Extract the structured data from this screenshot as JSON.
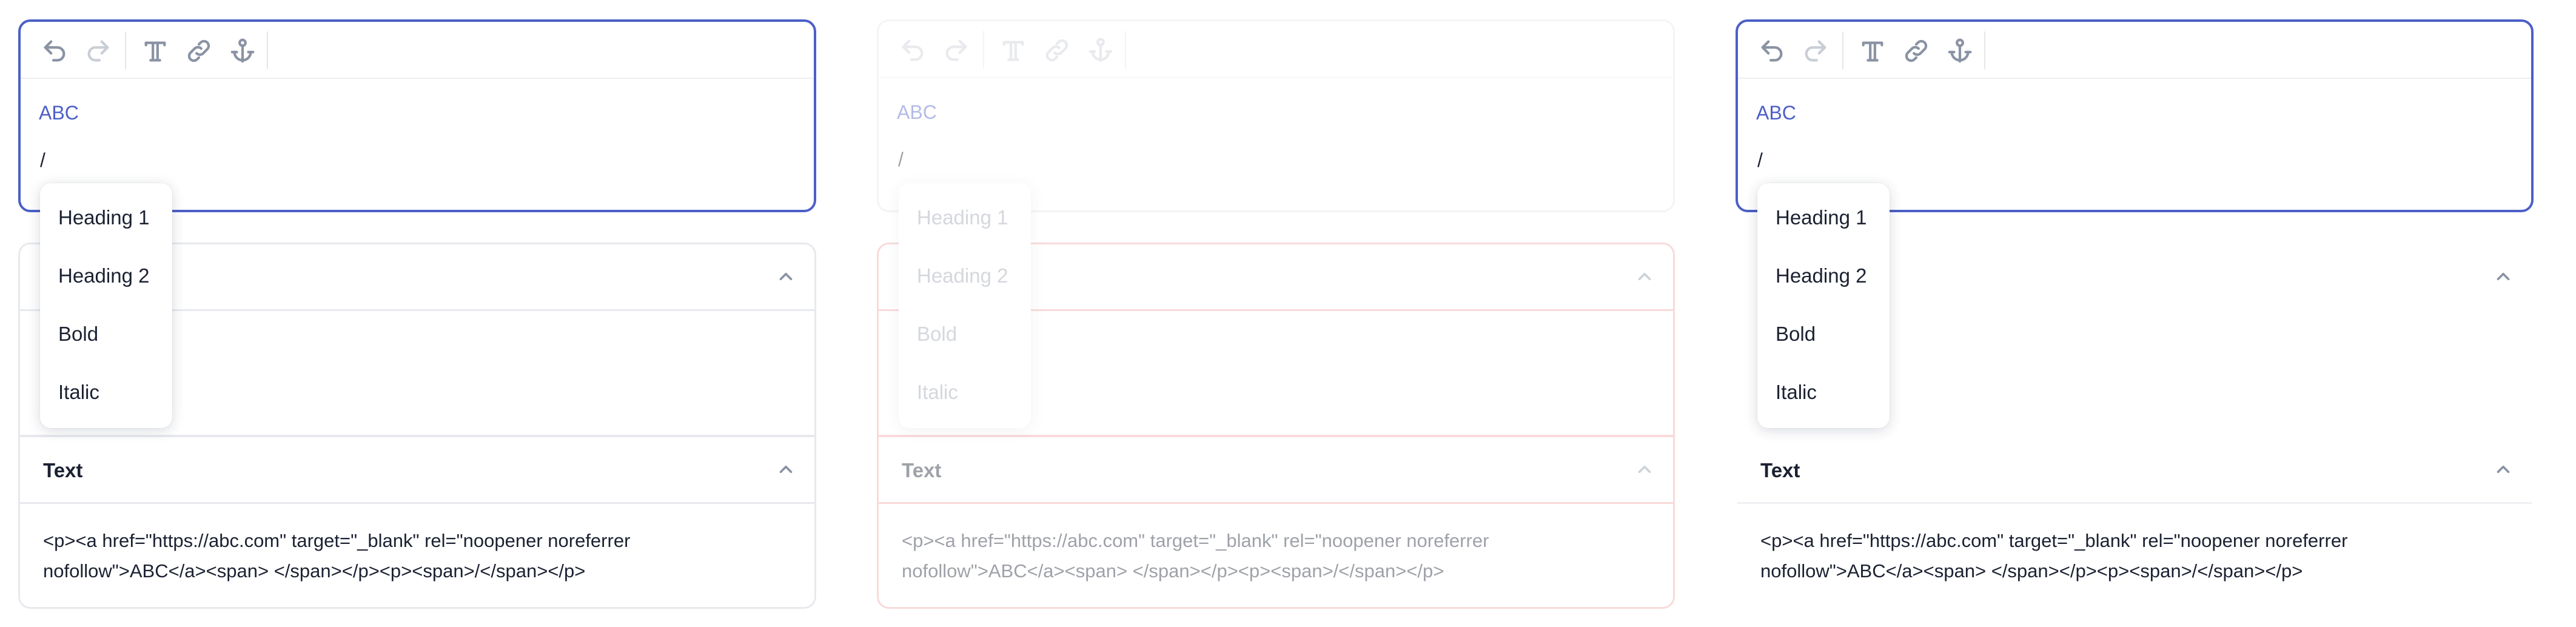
{
  "panels": [
    {
      "state": "focused",
      "toolbar": {
        "undo": "undo-icon",
        "redo": "redo-icon",
        "text_style": "text-style-icon",
        "link": "link-icon",
        "anchor": "anchor-icon"
      },
      "editor": {
        "link_text": "ABC",
        "slash_text": "/"
      },
      "menu": [
        "Heading 1",
        "Heading 2",
        "Bold",
        "Italic"
      ],
      "sections": [
        {
          "title": ""
        },
        {
          "title": "Text",
          "html_output": "<p><a href=\"https://abc.com\" target=\"_blank\" rel=\"noopener noreferrer nofollow\">ABC</a><span> </span></p><p><span>/</span></p>"
        }
      ]
    },
    {
      "state": "disabled",
      "toolbar": {
        "undo": "undo-icon",
        "redo": "redo-icon",
        "text_style": "text-style-icon",
        "link": "link-icon",
        "anchor": "anchor-icon"
      },
      "editor": {
        "link_text": "ABC",
        "slash_text": "/"
      },
      "menu": [
        "Heading 1",
        "Heading 2",
        "Bold",
        "Italic"
      ],
      "sections": [
        {
          "title": ""
        },
        {
          "title": "Text",
          "html_output": "<p><a href=\"https://abc.com\" target=\"_blank\" rel=\"noopener noreferrer nofollow\">ABC</a><span> </span></p><p><span>/</span></p>"
        }
      ]
    },
    {
      "state": "focused",
      "toolbar": {
        "undo": "undo-icon",
        "redo": "redo-icon",
        "text_style": "text-style-icon",
        "link": "link-icon",
        "anchor": "anchor-icon"
      },
      "editor": {
        "link_text": "ABC",
        "slash_text": "/"
      },
      "menu": [
        "Heading 1",
        "Heading 2",
        "Bold",
        "Italic"
      ],
      "sections": [
        {
          "title": ""
        },
        {
          "title": "Text",
          "html_output": "<p><a href=\"https://abc.com\" target=\"_blank\" rel=\"noopener noreferrer nofollow\">ABC</a><span> </span></p><p><span>/</span></p>"
        }
      ]
    }
  ],
  "colors": {
    "accent": "#4c5fc7",
    "border": "#e7e9ed",
    "error_border": "#f2a8a8",
    "text": "#1b2131",
    "icon": "#8a93a3"
  }
}
